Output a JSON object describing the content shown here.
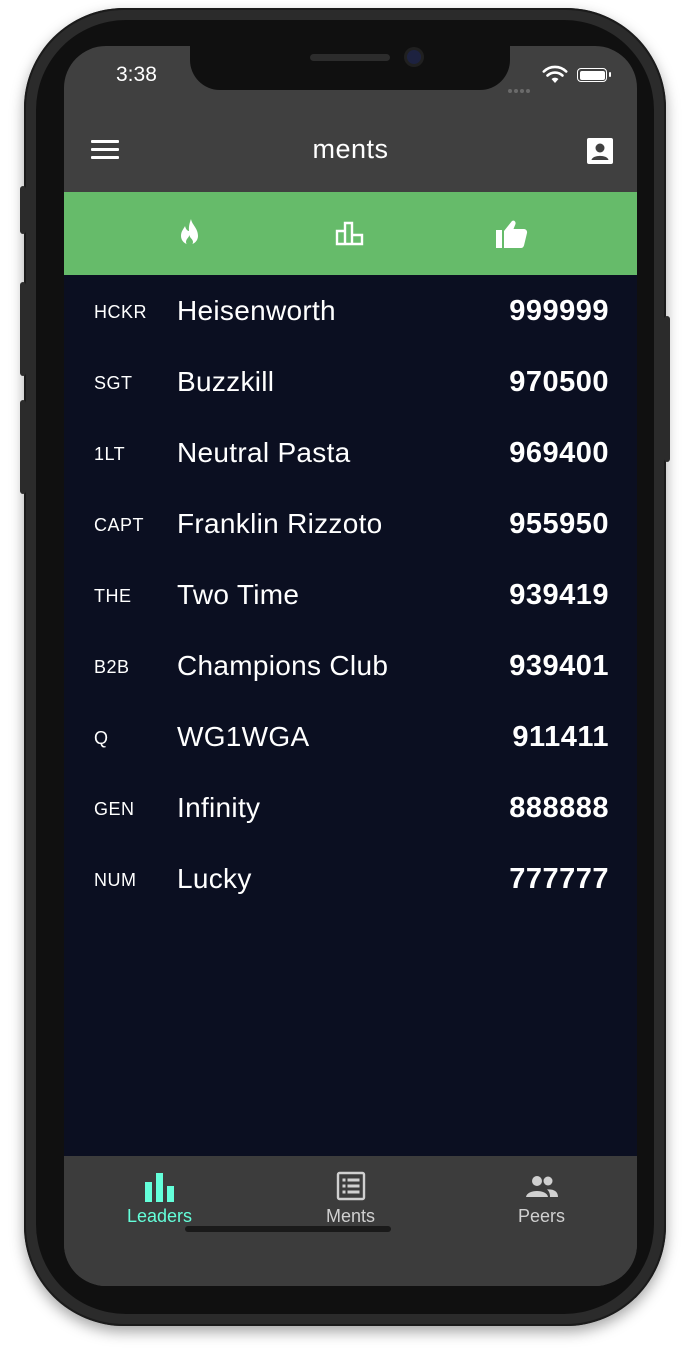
{
  "status": {
    "time": "3:38"
  },
  "appbar": {
    "title": "ments"
  },
  "tabs": [
    {
      "icon": "fire-icon"
    },
    {
      "icon": "podium-icon"
    },
    {
      "icon": "thumbs-up-icon"
    }
  ],
  "leaderboard": [
    {
      "rank": "HCKR",
      "name": "Heisenworth",
      "score": "999999"
    },
    {
      "rank": "SGT",
      "name": "Buzzkill",
      "score": "970500"
    },
    {
      "rank": "1LT",
      "name": "Neutral Pasta",
      "score": "969400"
    },
    {
      "rank": "CAPT",
      "name": "Franklin Rizzoto",
      "score": "955950"
    },
    {
      "rank": "THE",
      "name": "Two Time",
      "score": "939419"
    },
    {
      "rank": "B2B",
      "name": "Champions Club",
      "score": "939401"
    },
    {
      "rank": "Q",
      "name": "WG1WGA",
      "score": "911411"
    },
    {
      "rank": "GEN",
      "name": "Infinity",
      "score": "888888"
    },
    {
      "rank": "NUM",
      "name": "Lucky",
      "score": "777777"
    }
  ],
  "bottom_nav": [
    {
      "label": "Leaders",
      "icon": "bar-chart-icon",
      "active": true
    },
    {
      "label": "Ments",
      "icon": "list-icon",
      "active": false
    },
    {
      "label": "Peers",
      "icon": "people-icon",
      "active": false
    }
  ],
  "colors": {
    "active_nav": "#64ffda",
    "inactive_nav": "#d0d0d0",
    "tab_bar": "#66bb6a",
    "list_bg": "#0b0f21",
    "appbar_bg": "#404040"
  }
}
